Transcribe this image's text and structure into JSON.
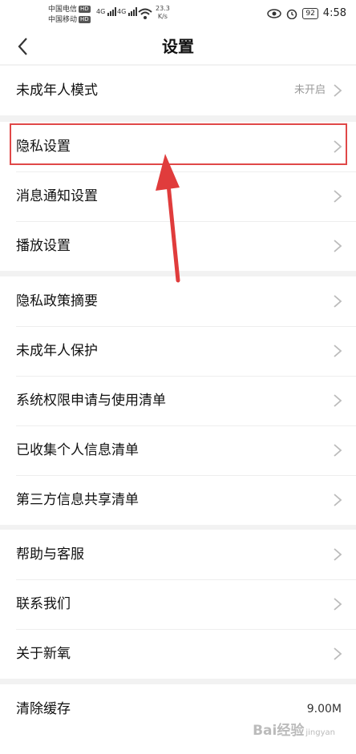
{
  "status_bar": {
    "carrier1": "中国电信",
    "carrier2": "中国移动",
    "hd": "HD",
    "sig1": "4G",
    "sig2": "4G",
    "speed_value": "23.3",
    "speed_unit": "K/s",
    "battery": "92",
    "time": "4:58"
  },
  "header": {
    "title": "设置"
  },
  "settings": {
    "group1": [
      {
        "label": "未成年人模式",
        "value": "未开启"
      }
    ],
    "group2": [
      {
        "label": "隐私设置"
      },
      {
        "label": "消息通知设置"
      },
      {
        "label": "播放设置"
      }
    ],
    "group3": [
      {
        "label": "隐私政策摘要"
      },
      {
        "label": "未成年人保护"
      },
      {
        "label": "系统权限申请与使用清单"
      },
      {
        "label": "已收集个人信息清单"
      },
      {
        "label": "第三方信息共享清单"
      }
    ],
    "group4": [
      {
        "label": "帮助与客服"
      },
      {
        "label": "联系我们"
      },
      {
        "label": "关于新氧"
      }
    ],
    "group5": [
      {
        "label": "清除缓存",
        "value": "9.00M"
      }
    ]
  },
  "watermark": {
    "text": "Bai经验",
    "sub": "jingyan"
  }
}
